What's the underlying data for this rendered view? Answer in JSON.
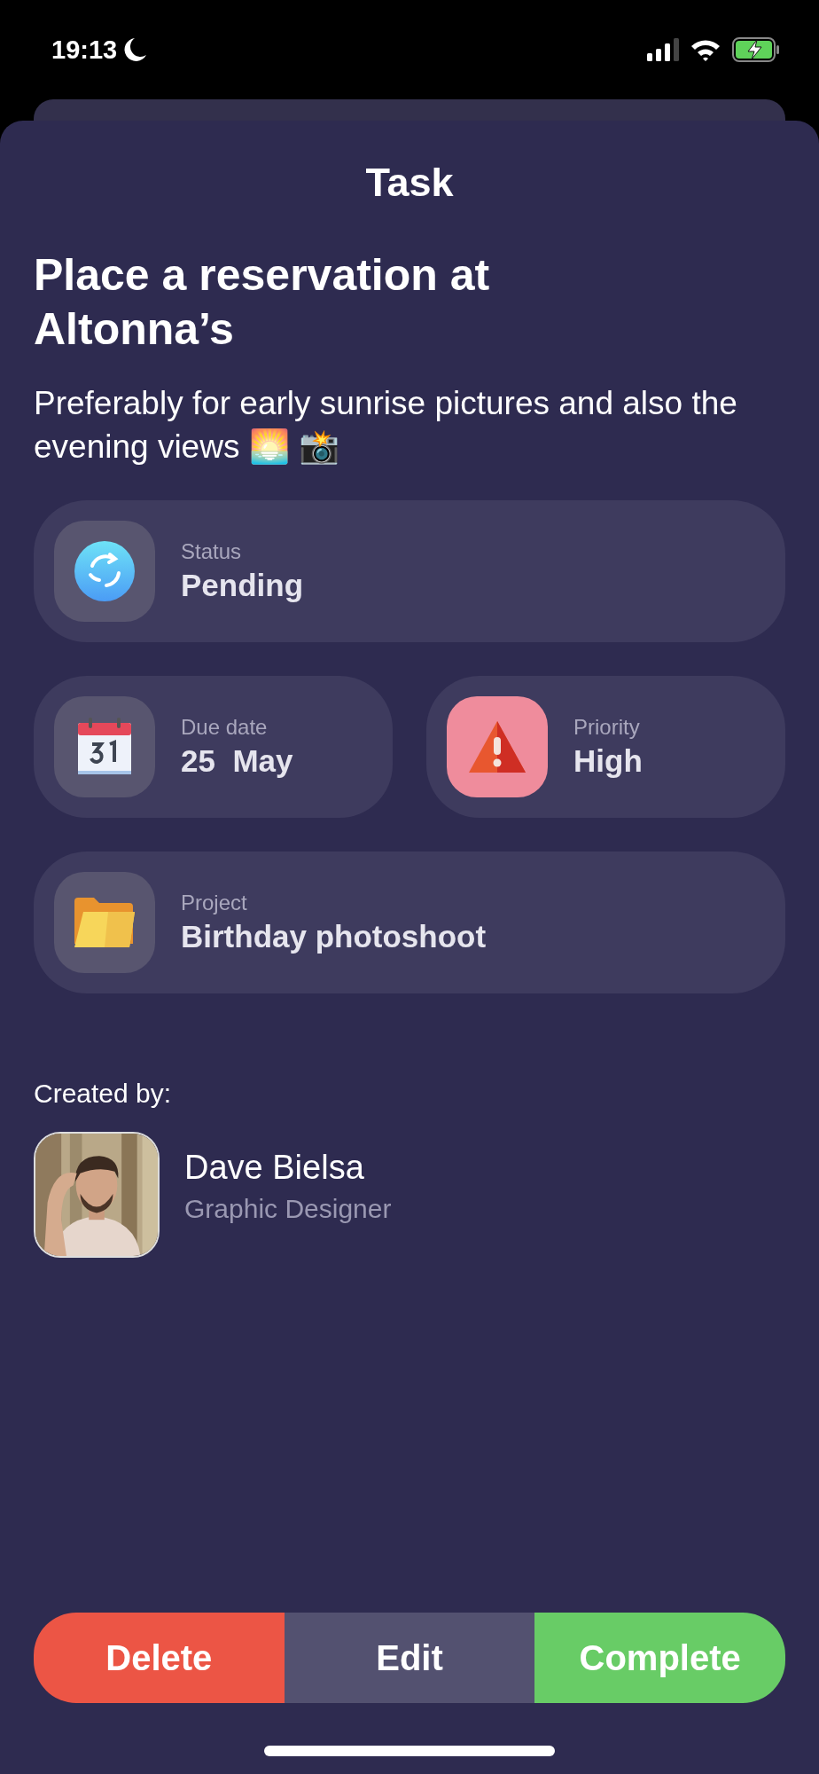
{
  "status_bar": {
    "time": "19:13"
  },
  "sheet": {
    "title": "Task"
  },
  "task": {
    "title": "Place a reservation at Altonna’s",
    "description": "Preferably for early sunrise pictures and also the evening views 🌅 📸"
  },
  "details": [
    {
      "kind": "status",
      "label": "Status",
      "value": "Pending"
    },
    {
      "kind": "date",
      "label": "Due date",
      "value": "25  May"
    },
    {
      "kind": "priority",
      "label": "Priority",
      "value": "High"
    },
    {
      "kind": "project",
      "label": "Project",
      "value": "Birthday photoshoot"
    }
  ],
  "creator": {
    "heading": "Created by:",
    "name": "Dave Bielsa",
    "role": "Graphic Designer"
  },
  "actions": [
    {
      "kind": "delete",
      "label": "Delete"
    },
    {
      "kind": "edit",
      "label": "Edit"
    },
    {
      "kind": "complete",
      "label": "Complete"
    }
  ]
}
